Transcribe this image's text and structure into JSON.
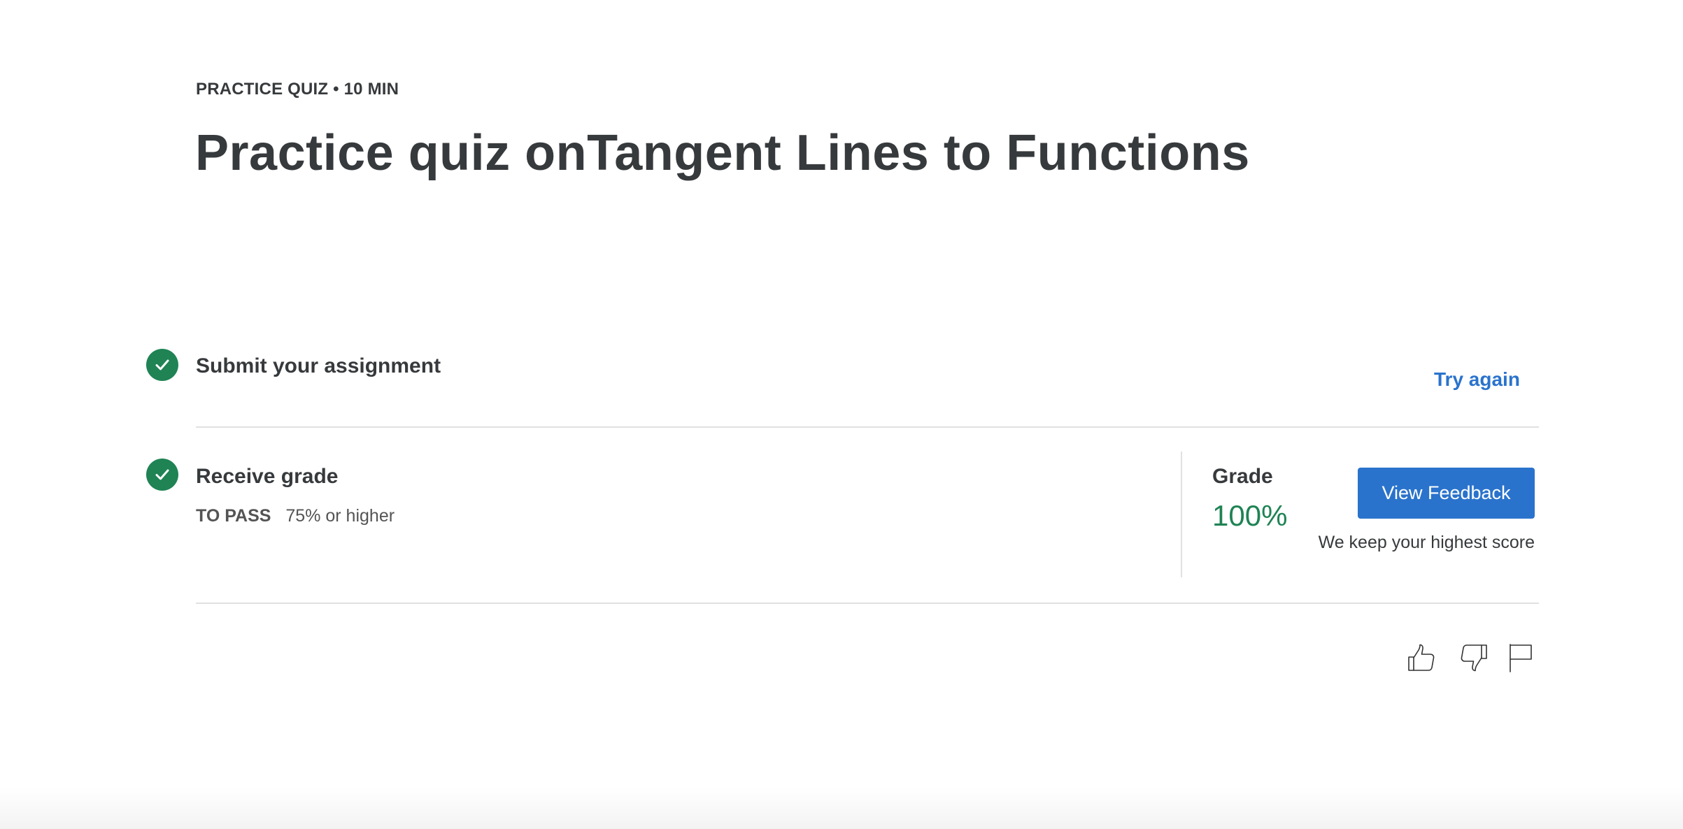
{
  "header": {
    "eyebrow": "PRACTICE QUIZ • 10 MIN",
    "title": "Practice quiz onTangent Lines to Functions"
  },
  "steps": [
    {
      "title": "Submit your assignment",
      "status_icon": "check-circle-icon",
      "action_label": "Try again"
    },
    {
      "title": "Receive grade",
      "status_icon": "check-circle-icon",
      "pass_label": "TO PASS",
      "pass_value": "75% or higher"
    }
  ],
  "grade": {
    "label": "Grade",
    "value": "100%",
    "button_label": "View Feedback",
    "note": "We keep your highest score"
  },
  "feedback_icons": [
    "thumbs-up-icon",
    "thumbs-down-icon",
    "flag-icon"
  ],
  "colors": {
    "text": "#373a3c",
    "success": "#1f8354",
    "primary": "#2a73cc",
    "divider": "#e1e1e1"
  }
}
